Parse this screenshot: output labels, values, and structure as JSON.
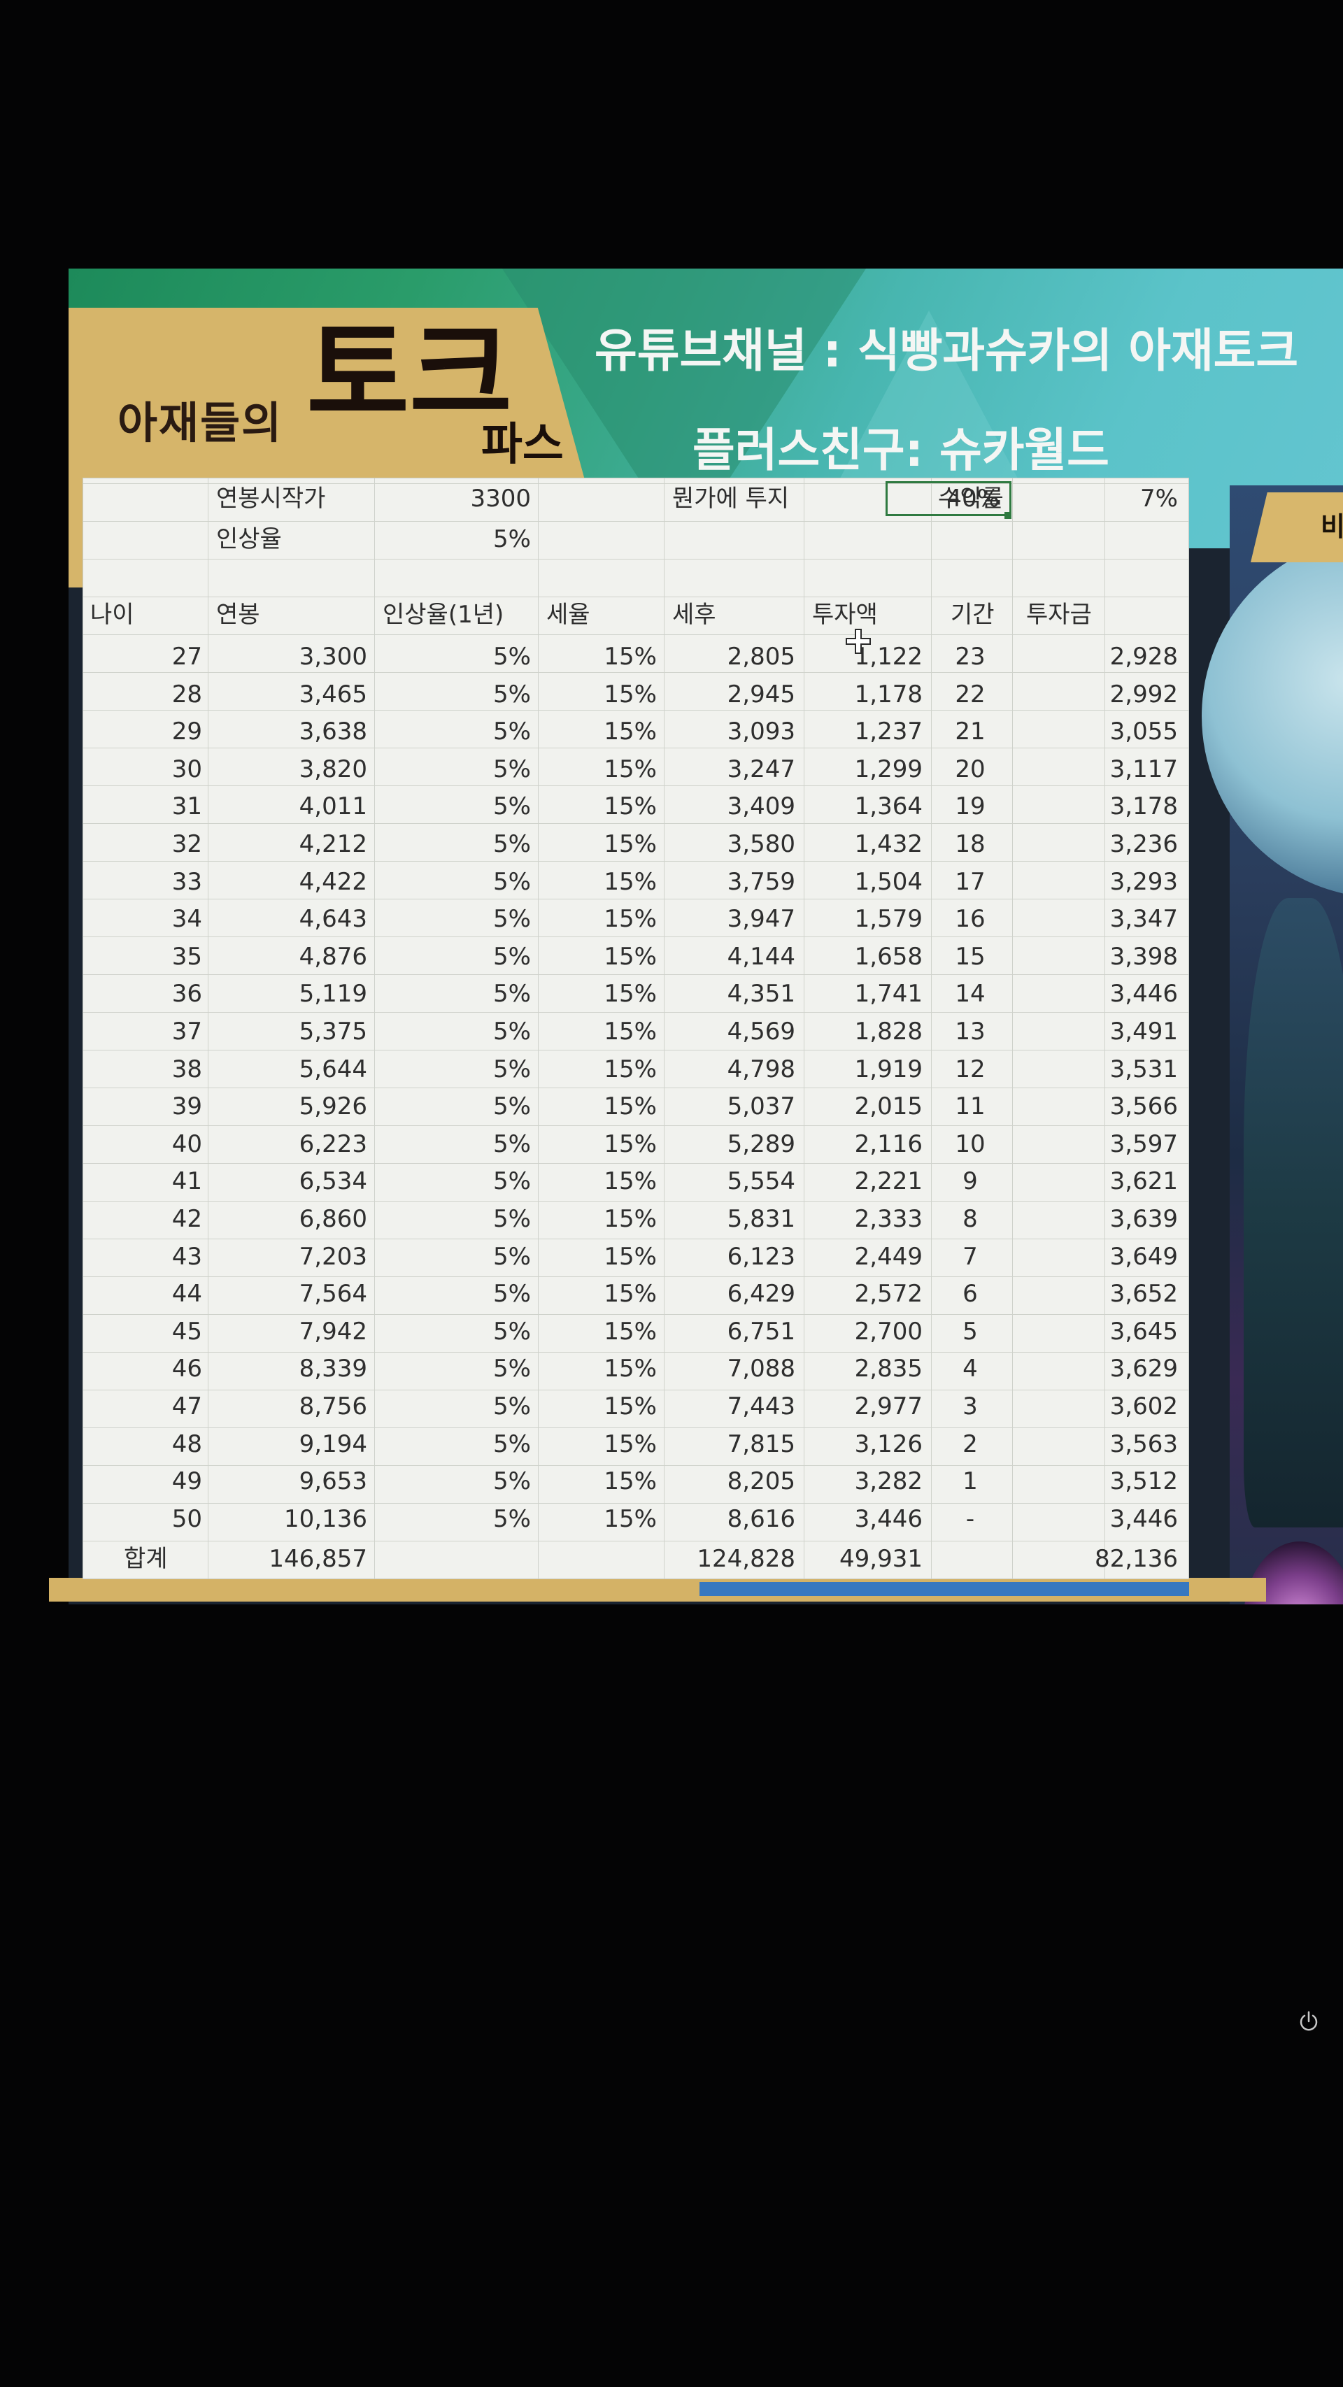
{
  "banner": {
    "logo_small": "아재들의",
    "logo_big": "토크",
    "logo_under": "파스",
    "title": "유튜브채널 : 식빵과슈카의 아재토크",
    "subtitle": "플러스친구: 슈카월드",
    "side_tab": "비"
  },
  "params": {
    "start_salary_label": "연봉시작가",
    "start_salary_value": "3300",
    "raise_label": "인상율",
    "raise_value": "5%",
    "invest_label": "뭔가에 투지",
    "invest_value": "40%",
    "return_label": "수익률",
    "return_value": "7%"
  },
  "headers": {
    "age": "나이",
    "salary": "연봉",
    "raise": "인상율(1년)",
    "tax": "세율",
    "after_tax": "세후",
    "investment": "투자액",
    "period": "기간",
    "fund": "투자금"
  },
  "rows": [
    [
      "27",
      "3,300",
      "5%",
      "15%",
      "2,805",
      "1,122",
      "23",
      "2,928"
    ],
    [
      "28",
      "3,465",
      "5%",
      "15%",
      "2,945",
      "1,178",
      "22",
      "2,992"
    ],
    [
      "29",
      "3,638",
      "5%",
      "15%",
      "3,093",
      "1,237",
      "21",
      "3,055"
    ],
    [
      "30",
      "3,820",
      "5%",
      "15%",
      "3,247",
      "1,299",
      "20",
      "3,117"
    ],
    [
      "31",
      "4,011",
      "5%",
      "15%",
      "3,409",
      "1,364",
      "19",
      "3,178"
    ],
    [
      "32",
      "4,212",
      "5%",
      "15%",
      "3,580",
      "1,432",
      "18",
      "3,236"
    ],
    [
      "33",
      "4,422",
      "5%",
      "15%",
      "3,759",
      "1,504",
      "17",
      "3,293"
    ],
    [
      "34",
      "4,643",
      "5%",
      "15%",
      "3,947",
      "1,579",
      "16",
      "3,347"
    ],
    [
      "35",
      "4,876",
      "5%",
      "15%",
      "4,144",
      "1,658",
      "15",
      "3,398"
    ],
    [
      "36",
      "5,119",
      "5%",
      "15%",
      "4,351",
      "1,741",
      "14",
      "3,446"
    ],
    [
      "37",
      "5,375",
      "5%",
      "15%",
      "4,569",
      "1,828",
      "13",
      "3,491"
    ],
    [
      "38",
      "5,644",
      "5%",
      "15%",
      "4,798",
      "1,919",
      "12",
      "3,531"
    ],
    [
      "39",
      "5,926",
      "5%",
      "15%",
      "5,037",
      "2,015",
      "11",
      "3,566"
    ],
    [
      "40",
      "6,223",
      "5%",
      "15%",
      "5,289",
      "2,116",
      "10",
      "3,597"
    ],
    [
      "41",
      "6,534",
      "5%",
      "15%",
      "5,554",
      "2,221",
      "9",
      "3,621"
    ],
    [
      "42",
      "6,860",
      "5%",
      "15%",
      "5,831",
      "2,333",
      "8",
      "3,639"
    ],
    [
      "43",
      "7,203",
      "5%",
      "15%",
      "6,123",
      "2,449",
      "7",
      "3,649"
    ],
    [
      "44",
      "7,564",
      "5%",
      "15%",
      "6,429",
      "2,572",
      "6",
      "3,652"
    ],
    [
      "45",
      "7,942",
      "5%",
      "15%",
      "6,751",
      "2,700",
      "5",
      "3,645"
    ],
    [
      "46",
      "8,339",
      "5%",
      "15%",
      "7,088",
      "2,835",
      "4",
      "3,629"
    ],
    [
      "47",
      "8,756",
      "5%",
      "15%",
      "7,443",
      "2,977",
      "3",
      "3,602"
    ],
    [
      "48",
      "9,194",
      "5%",
      "15%",
      "7,815",
      "3,126",
      "2",
      "3,563"
    ],
    [
      "49",
      "9,653",
      "5%",
      "15%",
      "8,205",
      "3,282",
      "1",
      "3,512"
    ],
    [
      "50",
      "10,136",
      "5%",
      "15%",
      "8,616",
      "3,446",
      "-",
      "3,446"
    ]
  ],
  "totals": {
    "label": "합계",
    "salary": "146,857",
    "after_tax": "124,828",
    "investment": "49,931",
    "fund": "82,136"
  },
  "icons": {
    "power": "power-icon",
    "cursor": "cell-cursor-icon"
  },
  "colors": {
    "sheet_bg": "#f1f2ee",
    "selection": "#2f7a40",
    "banner_gold": "#d6b56a"
  }
}
